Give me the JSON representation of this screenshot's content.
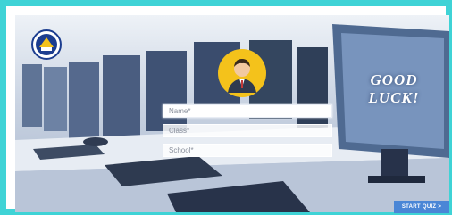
{
  "login": {
    "name_placeholder": "Name*",
    "class_placeholder": "Class*",
    "school_placeholder": "School*"
  },
  "banner": {
    "line1": "GOOD",
    "line2": "LUCK!"
  },
  "actions": {
    "start_label": "START QUIZ  >"
  },
  "icons": {
    "logo": "school-emblem-logo",
    "avatar": "student-avatar-icon"
  },
  "colors": {
    "frame_border": "#3fd3d6",
    "button": "#4a86d6",
    "avatar_bg": "#f4c21b"
  }
}
